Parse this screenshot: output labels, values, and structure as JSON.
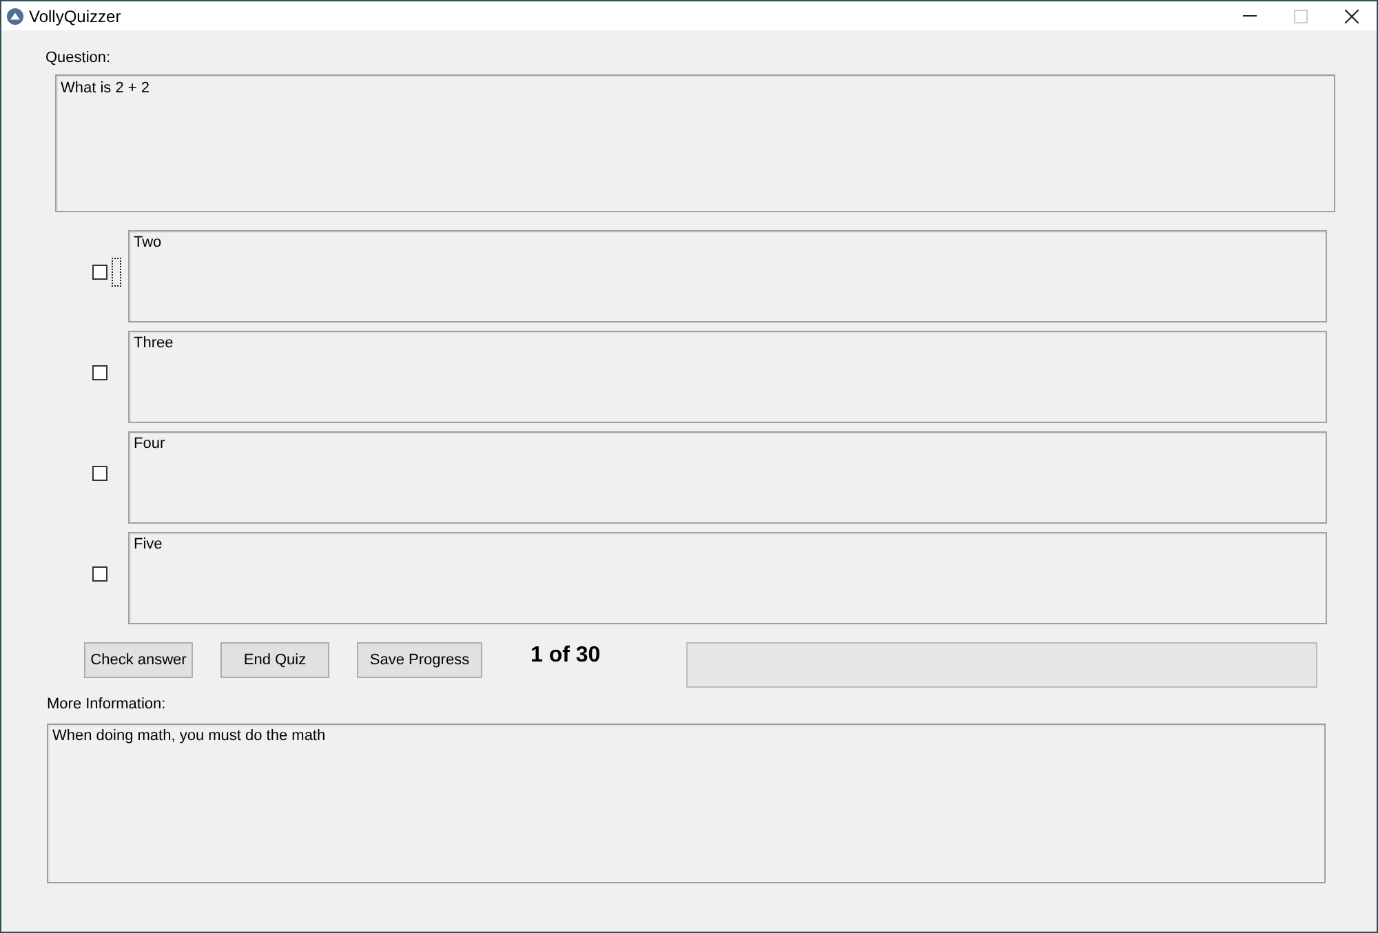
{
  "window": {
    "title": "VollyQuizzer",
    "controls": [
      {
        "kind": "minimize",
        "disabled": false
      },
      {
        "kind": "maximize",
        "disabled": true
      },
      {
        "kind": "close",
        "disabled": false
      }
    ]
  },
  "question": {
    "label": "Question:",
    "value": "What is 2 + 2"
  },
  "answers": [
    {
      "value": "Two",
      "checked": false,
      "focused": true
    },
    {
      "value": "Three",
      "checked": false,
      "focused": false
    },
    {
      "value": "Four",
      "checked": false,
      "focused": false
    },
    {
      "value": "Five",
      "checked": false,
      "focused": false
    }
  ],
  "buttons": [
    "Check answer",
    "End Quiz",
    "Save Progress"
  ],
  "counter": "1 of 30",
  "progress": {
    "level": 0
  },
  "more_information": {
    "label": "More Information:",
    "value": "When doing math, you must do the math"
  }
}
